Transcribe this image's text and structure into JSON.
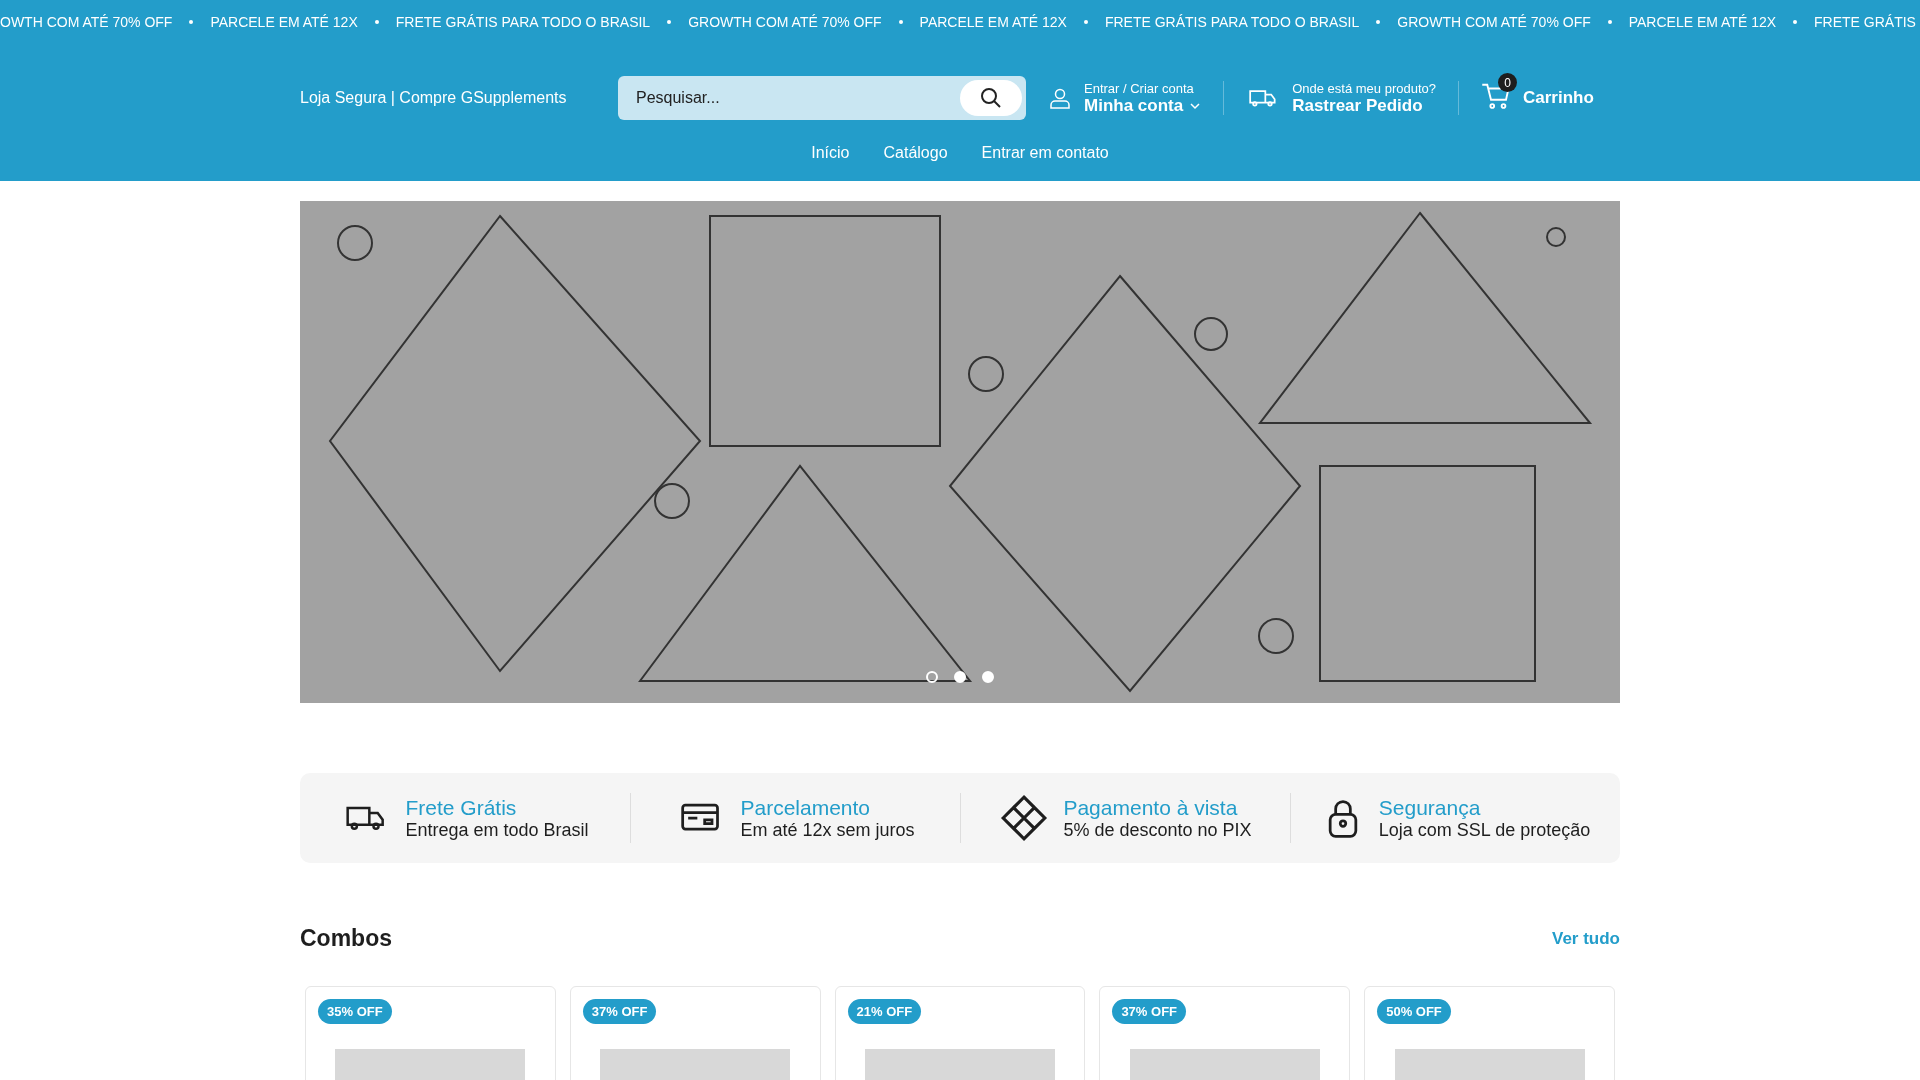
{
  "announcement_bar": {
    "items": [
      "OWTH COM ATÉ 70% OFF",
      "PARCELE EM ATÉ 12X",
      "FRETE GRÁTIS PARA TODO O BRASIL",
      "GROWTH COM ATÉ 70% OFF",
      "PARCELE EM ATÉ 12X",
      "FRETE GRÁTIS PARA TODO O BRASIL",
      "GROWTH COM ATÉ 70% OFF",
      "PARCELE EM ATÉ 12X",
      "FRETE GRÁTIS"
    ]
  },
  "header": {
    "tagline": "Loja Segura | Compre GSupplements",
    "search": {
      "placeholder": "Pesquisar..."
    },
    "account": {
      "small": "Entrar / Criar conta",
      "label": "Minha conta"
    },
    "tracking": {
      "small": "Onde está meu produto?",
      "label": "Rastrear Pedido"
    },
    "cart": {
      "count": "0",
      "label": "Carrinho"
    }
  },
  "nav": {
    "items": [
      "Início",
      "Catálogo",
      "Entrar em contato"
    ]
  },
  "slideshow": {
    "dots": [
      {
        "selected": true
      },
      {
        "selected": false
      },
      {
        "selected": false
      }
    ]
  },
  "features": [
    {
      "kind": "truck",
      "title": "Frete Grátis",
      "text": "Entrega em todo Brasil"
    },
    {
      "kind": "card",
      "title": "Parcelamento",
      "text": "Em até 12x sem juros"
    },
    {
      "kind": "pix",
      "title": "Pagamento à vista",
      "text": "5% de desconto no PIX"
    },
    {
      "kind": "lock",
      "title": "Segurança",
      "text": "Loja com SSL de proteção"
    }
  ],
  "combos": {
    "title": "Combos",
    "link": "Ver tudo",
    "products": [
      {
        "badge": "35% OFF"
      },
      {
        "badge": "37% OFF"
      },
      {
        "badge": "21% OFF"
      },
      {
        "badge": "37% OFF"
      },
      {
        "badge": "50% OFF"
      }
    ]
  }
}
